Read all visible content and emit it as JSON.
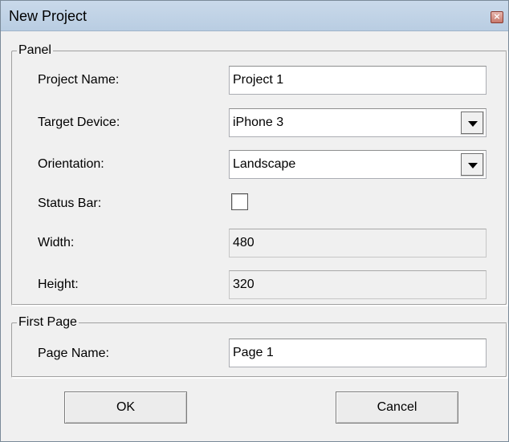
{
  "window": {
    "title": "New Project",
    "close_symbol": "×"
  },
  "panel": {
    "legend": "Panel",
    "project_name_label": "Project Name:",
    "project_name_value": "Project 1",
    "target_device_label": "Target Device:",
    "target_device_value": "iPhone 3",
    "orientation_label": "Orientation:",
    "orientation_value": "Landscape",
    "status_bar_label": "Status Bar:",
    "status_bar_checked": false,
    "width_label": "Width:",
    "width_value": "480",
    "height_label": "Height:",
    "height_value": "320"
  },
  "first_page": {
    "legend": "First Page",
    "page_name_label": "Page Name:",
    "page_name_value": "Page 1"
  },
  "buttons": {
    "ok": "OK",
    "cancel": "Cancel"
  },
  "icons": {
    "close": "close-icon",
    "dropdown": "chevron-down-icon"
  }
}
